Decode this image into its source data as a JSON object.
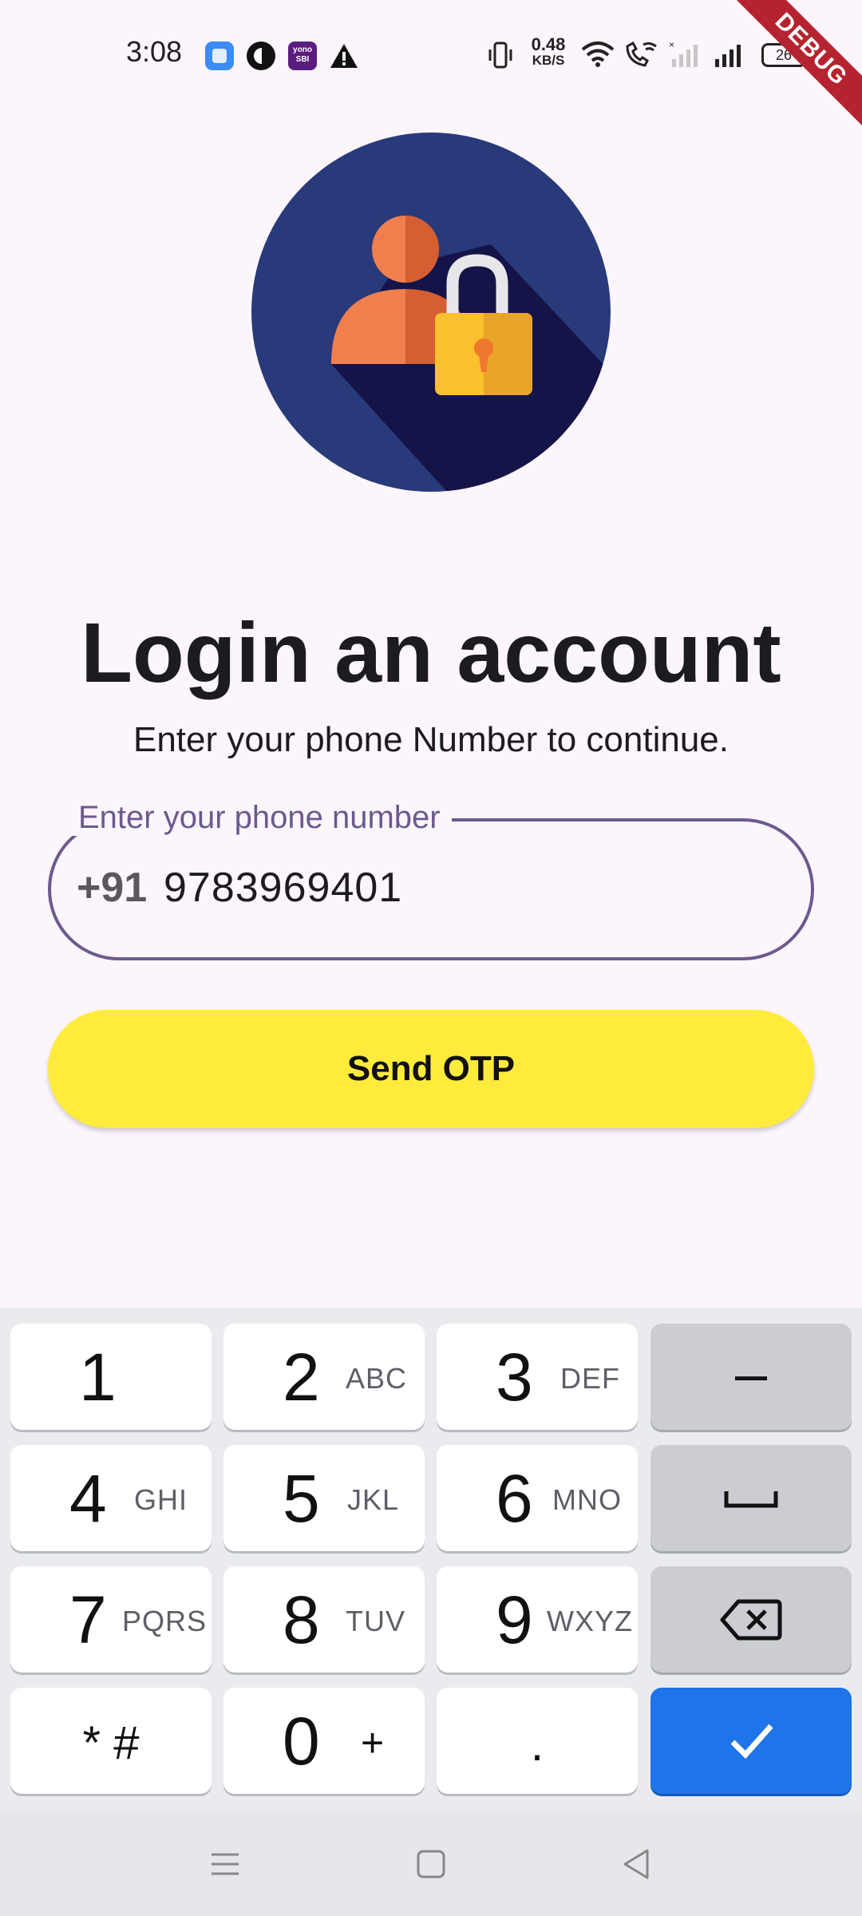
{
  "status_bar": {
    "time": "3:08",
    "net_speed_value": "0.48",
    "net_speed_unit": "KB/S",
    "battery": "26",
    "app_icons": [
      "square-app-icon",
      "contrast-app-icon",
      "yono-sbi-icon",
      "warning-icon"
    ],
    "yono_label": "yono SBI"
  },
  "debug_banner": "DEBUG",
  "hero": {
    "icon": "user-lock-illustration"
  },
  "heading": {
    "title": "Login an account",
    "subtitle": "Enter your phone Number to continue."
  },
  "phone_field": {
    "label": "Enter your phone number",
    "prefix": "+91",
    "value": "9783969401"
  },
  "send_otp": {
    "label": "Send OTP"
  },
  "keyboard": {
    "rows": [
      [
        {
          "main": "1",
          "sub": ""
        },
        {
          "main": "2",
          "sub": "ABC"
        },
        {
          "main": "3",
          "sub": "DEF"
        },
        {
          "main": "–",
          "sub": ""
        }
      ],
      [
        {
          "main": "4",
          "sub": "GHI"
        },
        {
          "main": "5",
          "sub": "JKL"
        },
        {
          "main": "6",
          "sub": "MNO"
        },
        {
          "main": "space",
          "sub": ""
        }
      ],
      [
        {
          "main": "7",
          "sub": "PQRS"
        },
        {
          "main": "8",
          "sub": "TUV"
        },
        {
          "main": "9",
          "sub": "WXYZ"
        },
        {
          "main": "backspace",
          "sub": ""
        }
      ],
      [
        {
          "main": "* #",
          "sub": ""
        },
        {
          "main": "0",
          "sub": "+"
        },
        {
          "main": ".",
          "sub": ""
        },
        {
          "main": "done",
          "sub": ""
        }
      ]
    ],
    "colors": {
      "key": "#FFFFFF",
      "function_key": "#CBCDD3",
      "done_key": "#1E74E8"
    }
  },
  "nav_bar": {
    "buttons": [
      "menu-icon",
      "home-icon",
      "back-icon"
    ]
  },
  "colors": {
    "background": "#FDF5FC",
    "primary_outline": "#6A5A8E",
    "send_otp": "#FFEB3B",
    "debug_banner": "#B5232F"
  }
}
